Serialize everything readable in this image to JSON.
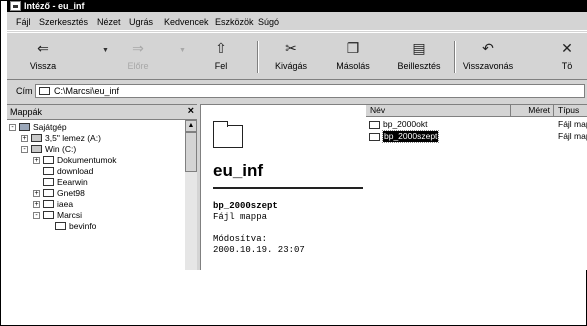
{
  "window": {
    "title": "Intéző - eu_inf"
  },
  "menu": [
    {
      "label": "Fájl"
    },
    {
      "label": "Szerkesztés"
    },
    {
      "label": "Nézet"
    },
    {
      "label": "Ugrás"
    },
    {
      "label": "Kedvencek"
    },
    {
      "label": "Eszközök"
    },
    {
      "label": "Súgó"
    }
  ],
  "toolbar": {
    "back": {
      "label": "Vissza",
      "icon": "back-arrow-icon"
    },
    "forward": {
      "label": "Előre",
      "icon": "forward-arrow-icon",
      "enabled": false
    },
    "up": {
      "label": "Fel",
      "icon": "up-folder-icon"
    },
    "cut": {
      "label": "Kivágás",
      "icon": "scissors-icon"
    },
    "copy": {
      "label": "Másolás",
      "icon": "copy-icon"
    },
    "paste": {
      "label": "Beillesztés",
      "icon": "paste-icon"
    },
    "undo": {
      "label": "Visszavonás",
      "icon": "undo-icon"
    },
    "delete": {
      "label": "Tö",
      "icon": "delete-icon"
    }
  },
  "address": {
    "label": "Cím",
    "value": "C:\\Marcsi\\eu_inf"
  },
  "folders_pane": {
    "title": "Mappák",
    "close": "×",
    "tree": [
      {
        "label": "Sajátgép",
        "expander": "-",
        "icon": "computer-icon"
      },
      {
        "label": "3,5\" lemez (A:)",
        "expander": "+",
        "icon": "floppy-icon"
      },
      {
        "label": "Win (C:)",
        "expander": "-",
        "icon": "drive-icon"
      },
      {
        "label": "Dokumentumok",
        "expander": "+",
        "icon": "documents-folder-icon"
      },
      {
        "label": "download",
        "expander": "",
        "icon": "folder-icon"
      },
      {
        "label": "Eearwin",
        "expander": "",
        "icon": "folder-icon"
      },
      {
        "label": "Gnet98",
        "expander": "+",
        "icon": "folder-icon"
      },
      {
        "label": "iaea",
        "expander": "+",
        "icon": "folder-icon"
      },
      {
        "label": "Marcsi",
        "expander": "-",
        "icon": "folder-icon"
      },
      {
        "label": "bevinfo",
        "expander": "",
        "icon": "folder-icon"
      }
    ]
  },
  "web_view": {
    "folder_name": "eu_inf",
    "selected_name": "bp_2000szept",
    "selected_type": "Fájl mappa",
    "modified_label": "Módosítva:",
    "modified_value": "2000.10.19. 23:07"
  },
  "file_list": {
    "columns": {
      "name": "Név",
      "size": "Méret",
      "type": "Típus"
    },
    "items": [
      {
        "name": "bp_2000okt",
        "size": "",
        "type": "Fájl mappa",
        "selected": false
      },
      {
        "name": "bp_2000szept",
        "size": "",
        "type": "Fájl mappa",
        "selected": true
      }
    ]
  }
}
